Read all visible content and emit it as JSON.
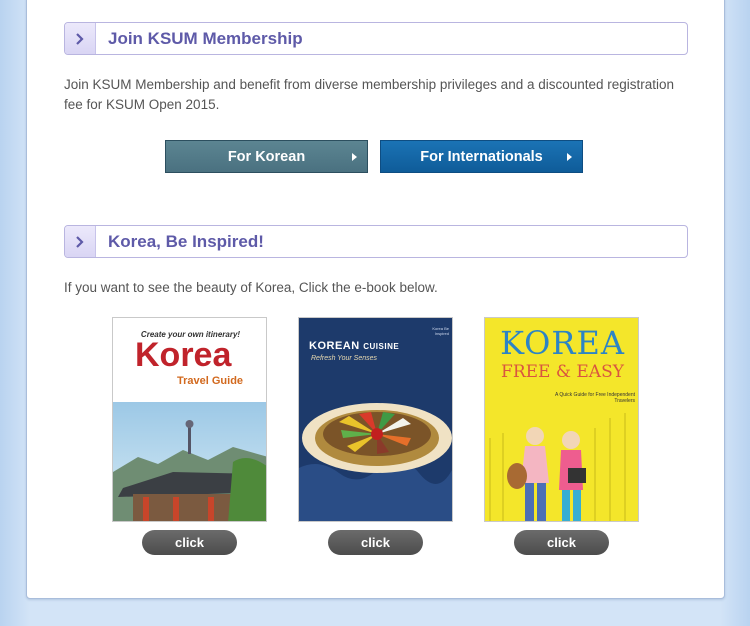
{
  "membership": {
    "title": "Join KSUM Membership",
    "description": "Join KSUM Membership and benefit from diverse membership privileges and a discounted registration fee for KSUM Open 2015.",
    "btn_korean": "For Korean",
    "btn_international": "For Internationals"
  },
  "inspired": {
    "title": "Korea, Be Inspired!",
    "description": "If you want to see the beauty of Korea, Click the e-book below."
  },
  "ebooks": [
    {
      "tagline": "Create your own itinerary!",
      "title": "Korea",
      "subtitle": "Travel Guide",
      "click_label": "click"
    },
    {
      "title": "KOREAN",
      "title_suffix": "CUISINE",
      "subtitle": "Refresh Your Senses",
      "publisher": "Korea Be Inspired",
      "click_label": "click"
    },
    {
      "title": "KOREA",
      "subtitle": "FREE & EASY",
      "tagline": "A Quick Guide for Free Independent Travelers",
      "click_label": "click"
    }
  ],
  "colors": {
    "accent_purple": "#5e5aa8",
    "btn_korean": "#4f7785",
    "btn_international": "#1467a8",
    "page_bg": "#d3e4f7"
  }
}
